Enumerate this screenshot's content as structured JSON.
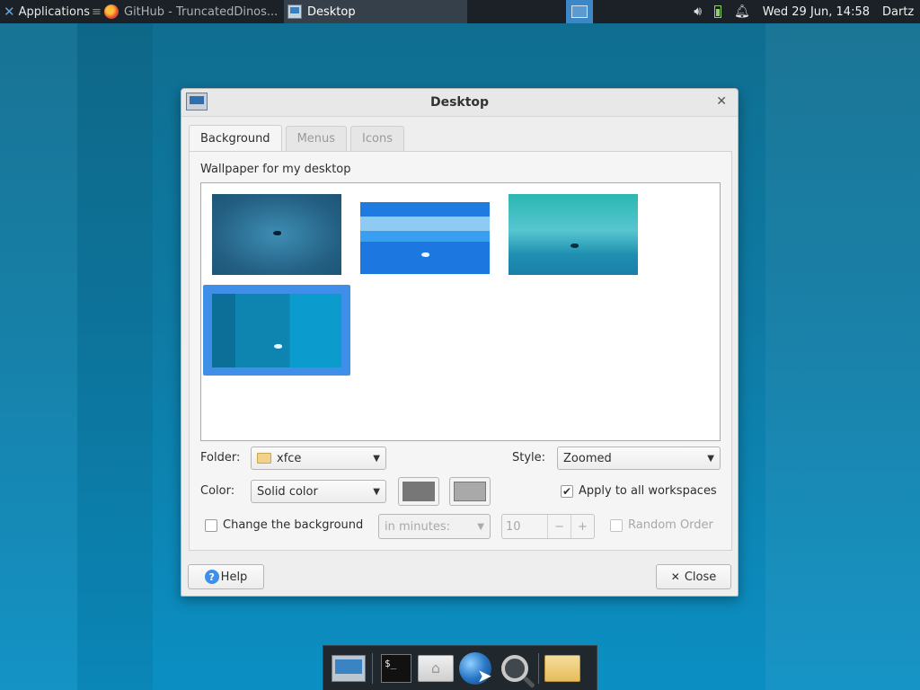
{
  "top_panel": {
    "applications_label": "Applications",
    "applications_icon": "xfce-logo-icon",
    "tasks": [
      {
        "label": "GitHub - TruncatedDinos...",
        "icon": "firefox-icon",
        "active": false
      },
      {
        "label": "Desktop",
        "icon": "desktop-settings-icon",
        "active": true
      }
    ],
    "tray": {
      "volume_icon": "speaker-icon",
      "battery_icon": "battery-icon",
      "notification_icon": "bell-icon",
      "clock": "Wed 29 Jun, 14:58",
      "user": "Dartz"
    }
  },
  "dialog": {
    "title": "Desktop",
    "tabs": [
      {
        "label": "Background",
        "selected": true
      },
      {
        "label": "Menus",
        "selected": false
      },
      {
        "label": "Icons",
        "selected": false
      }
    ],
    "wallpaper_label": "Wallpaper for my desktop",
    "wallpapers": [
      {
        "name": "wallpaper-1",
        "selected": false
      },
      {
        "name": "wallpaper-2",
        "selected": false
      },
      {
        "name": "wallpaper-3",
        "selected": false
      },
      {
        "name": "wallpaper-4",
        "selected": true
      }
    ],
    "folder_label": "Folder:",
    "folder_value": "xfce",
    "style_label": "Style:",
    "style_value": "Zoomed",
    "color_label": "Color:",
    "color_value": "Solid color",
    "color_swatch_1": "#777777",
    "color_swatch_2": "#a9a9a9",
    "apply_all_label": "Apply to all workspaces",
    "apply_all_checked": true,
    "change_bg_label": "Change the background",
    "change_bg_checked": false,
    "interval_value": "in minutes:",
    "interval_amount": "10",
    "spin_minus": "−",
    "spin_plus": "+",
    "random_label": "Random Order",
    "random_checked": false,
    "help_label": "Help",
    "close_label": "Close"
  },
  "dock": {
    "items": [
      "show-desktop-icon",
      "terminal-icon",
      "home-folder-icon",
      "web-browser-icon",
      "search-icon",
      "folder-icon"
    ],
    "terminal_prompt": "$_"
  },
  "colors": {
    "accent": "#3f8fe8",
    "panel": "#1b2127"
  }
}
